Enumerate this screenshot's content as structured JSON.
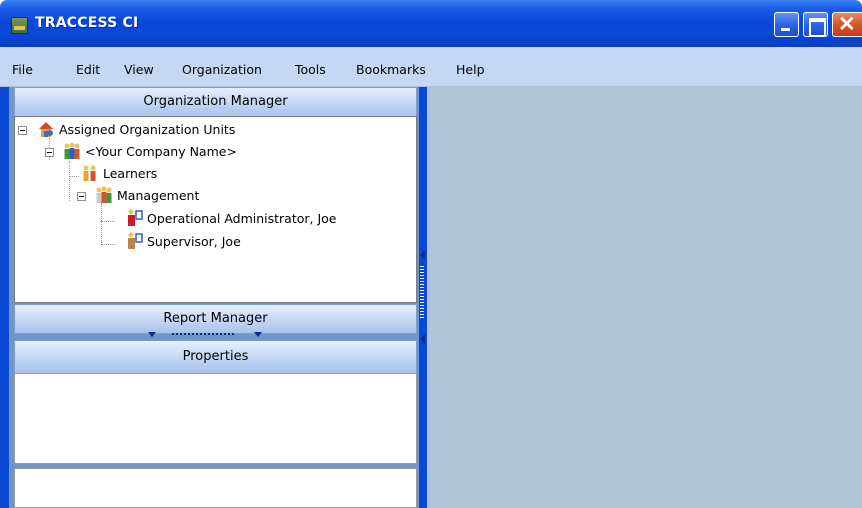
{
  "window": {
    "title": "TRACCESS CI"
  },
  "menu": {
    "items": [
      "File",
      "Edit",
      "View",
      "Organization",
      "Tools",
      "Bookmarks",
      "Help"
    ]
  },
  "panels": {
    "org_manager": "Organization Manager",
    "report_manager": "Report Manager",
    "properties": "Properties"
  },
  "tree": {
    "root": "Assigned Organization Units",
    "company": "<Your Company Name>",
    "learners": "Learners",
    "management": "Management",
    "admin": "Operational Administrator, Joe",
    "supervisor": "Supervisor, Joe"
  },
  "icons": {
    "app": "traccess-app-icon",
    "root": "organization-house-icon",
    "company": "people-group-icon",
    "learners": "learners-group-icon",
    "management": "management-group-icon",
    "admin": "admin-person-icon",
    "supervisor": "supervisor-person-icon"
  },
  "colors": {
    "titlebar": "#0a48d6",
    "menubar": "#c5d7f3",
    "workspace": "#b0c3d9"
  }
}
